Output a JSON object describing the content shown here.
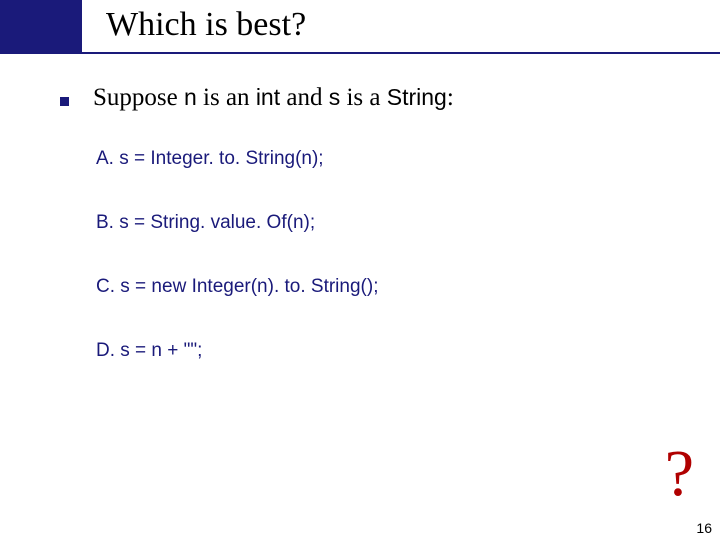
{
  "title": "Which is best?",
  "lead": {
    "t1": "Suppose ",
    "c1": "n",
    "t2": " is an ",
    "c2": "int",
    "t3": " and ",
    "c3": "s",
    "t4": " is a ",
    "c4": "String",
    "t5": ":"
  },
  "options": {
    "a": "A.  s = Integer. to. String(n);",
    "b": "B.  s = String. value. Of(n);",
    "c": "C.  s = new Integer(n). to. String();",
    "d": "D.  s = n + \"\";"
  },
  "question_mark": "?",
  "page_number": "16"
}
